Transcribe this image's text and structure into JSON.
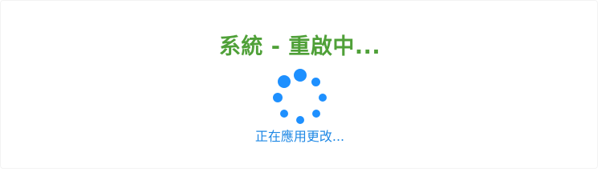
{
  "dialog": {
    "title": "系統 - 重啟中...",
    "status_text": "正在應用更改..."
  },
  "spinner": {
    "icon": "loading-spinner-icon",
    "dot_count": 8
  },
  "colors": {
    "title": "#4fa038",
    "spinner": "#1e90ff",
    "status_text": "#1e88e5",
    "background": "#ffffff"
  }
}
